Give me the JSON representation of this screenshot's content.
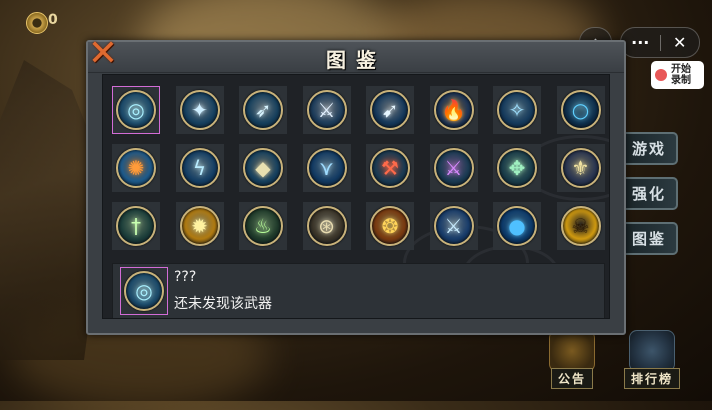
{
  "hud": {
    "coin_value": "0"
  },
  "system": {
    "home_icon": "⌂",
    "more_icon": "···",
    "close_icon": "✕",
    "record_label": "开始录制"
  },
  "side_menu": [
    "游戏",
    "强化",
    "图鉴"
  ],
  "bottom_buttons": [
    "公告",
    "排行榜"
  ],
  "panel": {
    "title": "图鉴",
    "close_icon": "✕"
  },
  "weapons": [
    {
      "icon": "ring-blade-icon",
      "glyph": "◎",
      "bg": "#1b4a6a",
      "fg": "#a9f0ff"
    },
    {
      "icon": "ice-claw-icon",
      "glyph": "✦",
      "bg": "#16405f",
      "fg": "#cdeeff"
    },
    {
      "icon": "frost-spear-icon",
      "glyph": "➶",
      "bg": "#163f5c",
      "fg": "#d8f4ff"
    },
    {
      "icon": "battle-axe-icon",
      "glyph": "⚔",
      "bg": "#1d3c5a",
      "fg": "#e3f1ff"
    },
    {
      "icon": "crossbow-icon",
      "glyph": "➹",
      "bg": "#15385a",
      "fg": "#e6f6ff"
    },
    {
      "icon": "triple-fire-icon",
      "glyph": "🔥",
      "bg": "#1c3456",
      "fg": "#ffb24a"
    },
    {
      "icon": "ice-flame-icon",
      "glyph": "✧",
      "bg": "#153a5c",
      "fg": "#9fe0ff"
    },
    {
      "icon": "blue-ring-icon",
      "glyph": "○",
      "bg": "#0f2f4c",
      "fg": "#5fd0ff"
    },
    {
      "icon": "fire-vortex-icon",
      "glyph": "✺",
      "bg": "#1e5a8a",
      "fg": "#ff9b3a"
    },
    {
      "icon": "lightning-lance-icon",
      "glyph": "ϟ",
      "bg": "#143e64",
      "fg": "#b8ecff"
    },
    {
      "icon": "kite-shuriken-icon",
      "glyph": "◆",
      "bg": "#16405e",
      "fg": "#e8e0b0"
    },
    {
      "icon": "triple-beam-icon",
      "glyph": "⋎",
      "bg": "#123a62",
      "fg": "#9fdcff"
    },
    {
      "icon": "crimson-sword-icon",
      "glyph": "⚒",
      "bg": "#1a3a52",
      "fg": "#ff6a4a"
    },
    {
      "icon": "violet-blade-icon",
      "glyph": "⚔",
      "bg": "#1a3a52",
      "fg": "#d98aff"
    },
    {
      "icon": "jade-glaive-icon",
      "glyph": "✥",
      "bg": "#1a3d4a",
      "fg": "#9ff0c0"
    },
    {
      "icon": "golden-axe-icon",
      "glyph": "⚜",
      "bg": "#2a3550",
      "fg": "#f0e2a0"
    },
    {
      "icon": "jade-greatsword-icon",
      "glyph": "†",
      "bg": "#1c3e3a",
      "fg": "#c8ffb0"
    },
    {
      "icon": "sun-disc-icon",
      "glyph": "✹",
      "bg": "#b07a10",
      "fg": "#fff2a0"
    },
    {
      "icon": "spirit-flame-icon",
      "glyph": "♨",
      "bg": "#1f3a2a",
      "fg": "#b8ff9a"
    },
    {
      "icon": "rune-circle-icon",
      "glyph": "⊛",
      "bg": "#3a3428",
      "fg": "#e8dcb0"
    },
    {
      "icon": "flame-swirl-icon",
      "glyph": "❂",
      "bg": "#7a3a10",
      "fg": "#ffd45a"
    },
    {
      "icon": "frost-blade-icon",
      "glyph": "⚔",
      "bg": "#183c6a",
      "fg": "#c8ecff"
    },
    {
      "icon": "water-orb-icon",
      "glyph": "●",
      "bg": "#0d3a6a",
      "fg": "#4fc0ff"
    },
    {
      "icon": "panther-head-icon",
      "glyph": "☠",
      "bg": "#d09a10",
      "fg": "#2a1a08"
    }
  ],
  "detail": {
    "icon": "ring-blade-icon",
    "name": "???",
    "description": "还未发现该武器"
  }
}
